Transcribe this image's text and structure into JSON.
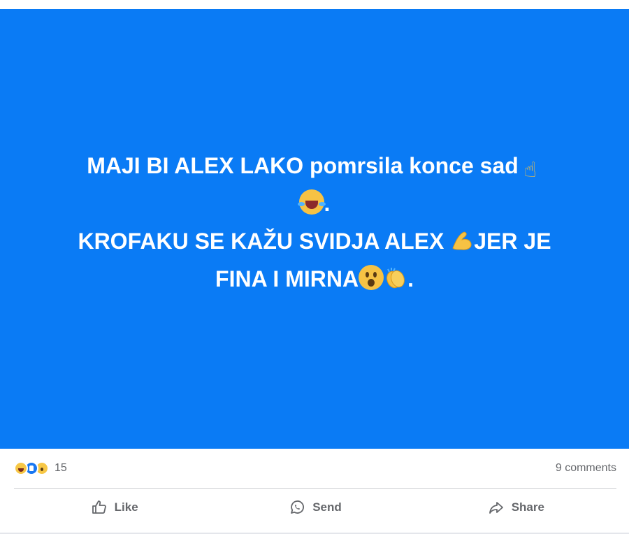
{
  "post": {
    "line1": "MAJI BI ALEX LAKO ",
    "line1_lower": "pomrsila konce sad",
    "line2_end": ".",
    "line3": "KROFAKU SE KAŽU SVIDJA ALEX ",
    "line3_end": "JER JE",
    "line4": "FINA I MIRNA",
    "line4_end": ".",
    "background_color": "#0a7bf5",
    "emojis": [
      "pointing-up-emoji",
      "rolling-laughing-emoji",
      "flexed-biceps-emoji",
      "astonished-emoji",
      "clapping-hands-emoji"
    ]
  },
  "stats": {
    "reaction_icons": [
      "haha",
      "like",
      "wow"
    ],
    "reaction_count": "15",
    "comments": "9 comments"
  },
  "actions": {
    "like": "Like",
    "send": "Send",
    "share": "Share"
  }
}
